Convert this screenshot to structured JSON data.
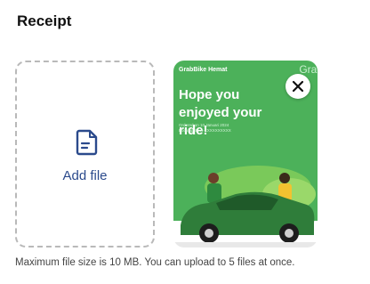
{
  "page": {
    "title": "Receipt",
    "hint": "Maximum file size is 10 MB. You can upload to 5 files at once."
  },
  "upload": {
    "label": "Add file",
    "icon": "document-icon"
  },
  "thumbnail": {
    "brand": "GrabBike Hemat",
    "brand_right": "Grab",
    "headline": "Hope you enjoyed your ride!",
    "meta_line1": "Ordered on 10 Januari 2024",
    "meta_line2": "Booking ID: A-XXXXXXXXXX",
    "close_icon": "close-icon"
  },
  "colors": {
    "accent": "#2b4a8c",
    "grab_green": "#4cb15a"
  }
}
